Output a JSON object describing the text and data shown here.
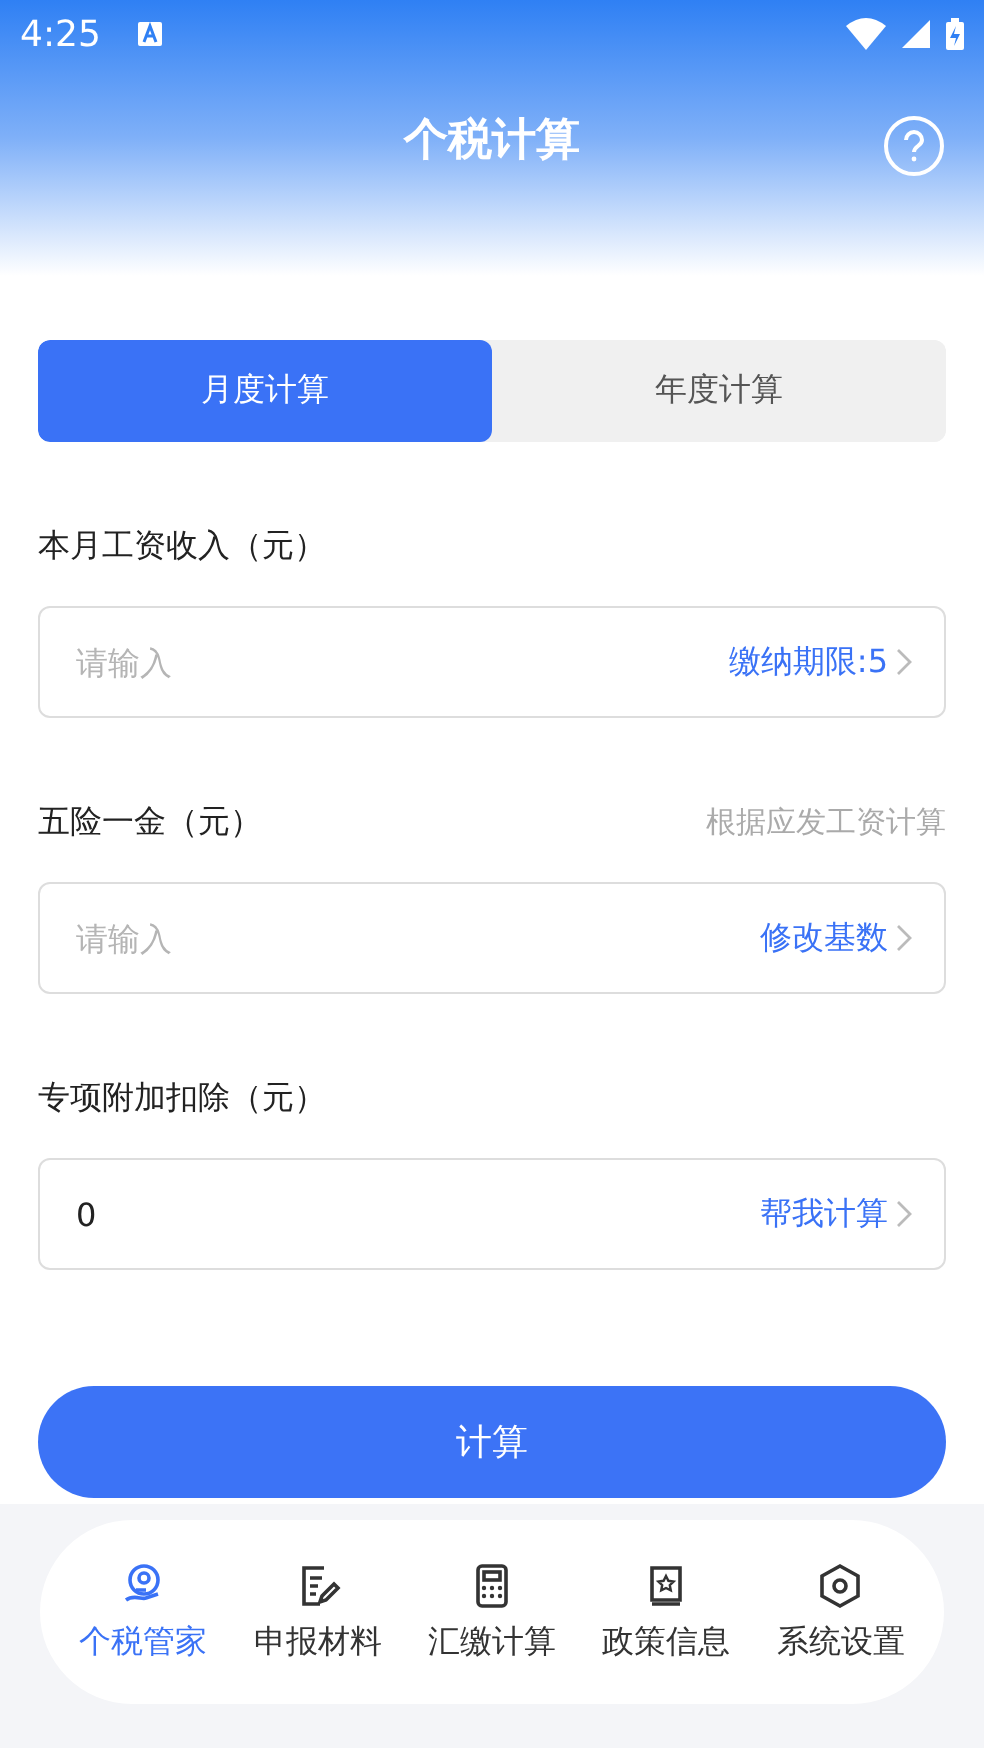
{
  "status_bar": {
    "time": "4:25"
  },
  "header": {
    "title": "个税计算"
  },
  "tabs": [
    {
      "label": "月度计算",
      "selected": true
    },
    {
      "label": "年度计算",
      "selected": false
    }
  ],
  "fields": [
    {
      "label": "本月工资收入（元）",
      "placeholder": "请输入",
      "action": "缴纳期限:5"
    },
    {
      "label": "五险一金（元）",
      "hint": "根据应发工资计算",
      "placeholder": "请输入",
      "action": "修改基数"
    },
    {
      "label": "专项附加扣除（元）",
      "value": "0",
      "action": "帮我计算"
    }
  ],
  "submit": "计算",
  "nav": [
    {
      "kind": "steward",
      "label": "个税管家",
      "selected": true
    },
    {
      "kind": "report",
      "label": "申报材料",
      "selected": false
    },
    {
      "kind": "calc",
      "label": "汇缴计算",
      "selected": false
    },
    {
      "kind": "policy",
      "label": "政策信息",
      "selected": false
    },
    {
      "kind": "settings",
      "label": "系统设置",
      "selected": false
    }
  ]
}
